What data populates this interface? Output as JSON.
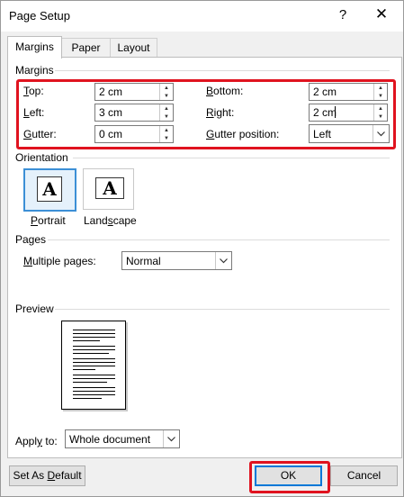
{
  "dialog": {
    "title": "Page Setup",
    "help": "?",
    "close": "✕"
  },
  "tabs": [
    "Margins",
    "Paper",
    "Layout"
  ],
  "margins": {
    "group_label": "Margins",
    "top": {
      "label": "Top:",
      "value": "2 cm"
    },
    "bottom": {
      "label": "Bottom:",
      "value": "2 cm"
    },
    "left": {
      "label": "Left:",
      "value": "3 cm"
    },
    "right": {
      "label": "Right:",
      "value": "2 cm"
    },
    "gutter": {
      "label": "Gutter:",
      "value": "0 cm"
    },
    "gutter_position": {
      "label": "Gutter position:",
      "value": "Left"
    }
  },
  "orientation": {
    "group_label": "Orientation",
    "portrait": "Portrait",
    "landscape": "Landscape",
    "selected": "Portrait",
    "glyph": "A"
  },
  "pages": {
    "group_label": "Pages",
    "multiple_pages_label": "Multiple pages:",
    "multiple_pages_value": "Normal"
  },
  "preview": {
    "group_label": "Preview"
  },
  "apply_to": {
    "label": "Apply to:",
    "value": "Whole document"
  },
  "buttons": {
    "set_default": "Set As Default",
    "ok": "OK",
    "cancel": "Cancel"
  },
  "colors": {
    "highlight": "#e0131f",
    "focus": "#0078d7"
  }
}
